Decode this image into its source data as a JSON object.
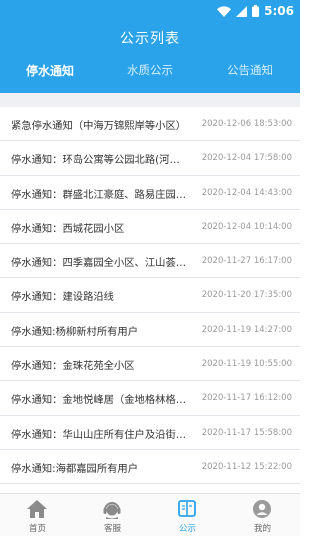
{
  "status_bar": {
    "time": "5:06"
  },
  "header": {
    "title": "公示列表"
  },
  "tabs": [
    {
      "label": "停水通知",
      "active": true
    },
    {
      "label": "水质公示",
      "active": false
    },
    {
      "label": "公告通知",
      "active": false
    }
  ],
  "notices": [
    {
      "title": "紧急停水通知（中海万锦熙岸等小区）",
      "date": "2020-12-06 18:53:00"
    },
    {
      "title": "停水通知：环岛公寓等公园北路(河…",
      "date": "2020-12-04 17:58:00"
    },
    {
      "title": "停水通知：群盛北江豪庭、路易庄园…",
      "date": "2020-12-04 14:43:00"
    },
    {
      "title": "停水通知：西城花园小区",
      "date": "2020-12-04 10:14:00"
    },
    {
      "title": "停水通知：四季嘉园全小区、江山荟…",
      "date": "2020-11-27 16:17:00"
    },
    {
      "title": "停水通知：建设路沿线",
      "date": "2020-11-20 17:35:00"
    },
    {
      "title": "停水通知:杨柳新村所有用户",
      "date": "2020-11-19 14:27:00"
    },
    {
      "title": "停水通知：金珠花苑全小区",
      "date": "2020-11-19 10:55:00"
    },
    {
      "title": "停水通知：金地悦峰居（金地格林格…",
      "date": "2020-11-17 16:12:00"
    },
    {
      "title": "停水通知：华山山庄所有住户及沿街…",
      "date": "2020-11-17 15:58:00"
    },
    {
      "title": "停水通知:海都嘉园所有用户",
      "date": "2020-11-12 15:22:00"
    }
  ],
  "bottom_nav": [
    {
      "label": "首页",
      "icon": "home-icon",
      "active": false
    },
    {
      "label": "客服",
      "icon": "customer-service-icon",
      "active": false
    },
    {
      "label": "公示",
      "icon": "notice-book-icon",
      "active": true
    },
    {
      "label": "我的",
      "icon": "profile-icon",
      "active": false
    }
  ],
  "colors": {
    "primary": "#2aa3ea",
    "divider": "#e3e6ea",
    "text": "#333333",
    "muted": "#9a9a9a"
  }
}
